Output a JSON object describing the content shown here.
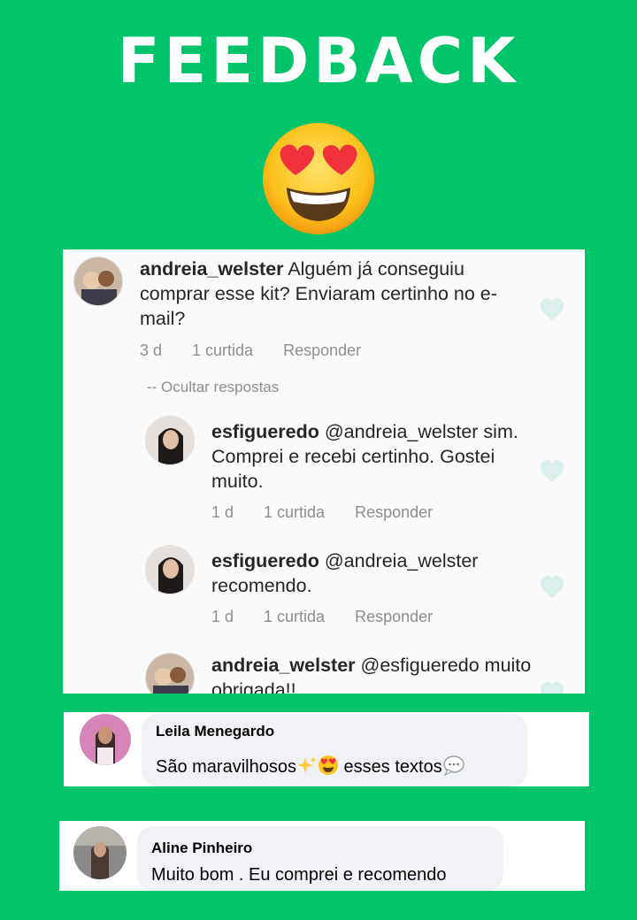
{
  "header": {
    "title": "FEEDBACK",
    "emoji": "heart-eyes-emoji"
  },
  "instagram": {
    "comments": [
      {
        "user": "andreia_welster",
        "text": " Alguém já conseguiu comprar esse kit? Enviaram certinho no e-mail?",
        "time": "3 d",
        "likes": "1 curtida",
        "reply": "Responder"
      },
      {
        "user": "esfigueredo",
        "text": " @andreia_welster sim. Comprei e recebi certinho. Gostei muito.",
        "time": "1 d",
        "likes": "1 curtida",
        "reply": "Responder"
      },
      {
        "user": "esfigueredo",
        "text": " @andreia_welster recomendo.",
        "time": "1 d",
        "likes": "1 curtida",
        "reply": "Responder"
      },
      {
        "user": "andreia_welster",
        "text": " @esfigueredo muito obrigada!!"
      }
    ],
    "hide_replies": "-- Ocultar respostas"
  },
  "facebook": {
    "comments": [
      {
        "name": "Leila Menegardo",
        "text_a": "São maravilhosos",
        "text_b": " esses textos",
        "icons": [
          "sparkles-icon",
          "heart-eyes-emoji",
          "speech-bubble-icon"
        ]
      },
      {
        "name": "Aline Pinheiro",
        "text": "Muito bom . Eu comprei e recomendo"
      }
    ]
  },
  "colors": {
    "background": "#00c46a",
    "card": "#fafafa",
    "meta_text": "#8e8e8e",
    "bubble": "#f0f2f5"
  }
}
